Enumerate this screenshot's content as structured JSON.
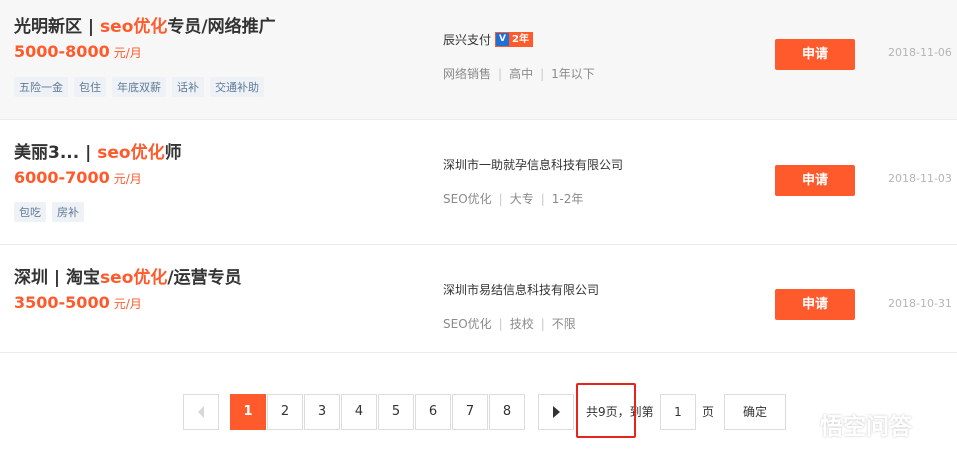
{
  "jobs": [
    {
      "title_pre": "光明新区 | ",
      "title_kw": "seo优化",
      "title_post": "专员/网络推广",
      "salary": "5000-8000",
      "salary_unit": "元/月",
      "tags": [
        "五险一金",
        "包住",
        "年底双薪",
        "话补",
        "交通补助"
      ],
      "company": "辰兴支付",
      "badge_text": "2年",
      "meta": [
        "网络销售",
        "高中",
        "1年以下"
      ],
      "apply_label": "申请",
      "date": "2018-11-06"
    },
    {
      "title_pre": "美丽3... | ",
      "title_kw": "seo优化",
      "title_post": "师",
      "salary": "6000-7000",
      "salary_unit": "元/月",
      "tags": [
        "包吃",
        "房补"
      ],
      "company": "深圳市一助就孕信息科技有限公司",
      "meta": [
        "SEO优化",
        "大专",
        "1-2年"
      ],
      "apply_label": "申请",
      "date": "2018-11-03"
    },
    {
      "title_pre": "深圳 | 淘宝",
      "title_kw": "seo优化",
      "title_post": "/运营专员",
      "salary": "3500-5000",
      "salary_unit": "元/月",
      "tags": [],
      "company": "深圳市易结信息科技有限公司",
      "meta": [
        "SEO优化",
        "技校",
        "不限"
      ],
      "apply_label": "申请",
      "date": "2018-10-31"
    }
  ],
  "pagination": {
    "pages": [
      "1",
      "2",
      "3",
      "4",
      "5",
      "6",
      "7",
      "8"
    ],
    "current": "1",
    "total_text": "共9页，到第",
    "goto_value": "1",
    "page_suffix": "页",
    "confirm_label": "确定"
  },
  "watermark": {
    "text": "悟空问答"
  },
  "colors": {
    "accent": "#ff5a2c",
    "highlight_box": "#e3251b"
  }
}
